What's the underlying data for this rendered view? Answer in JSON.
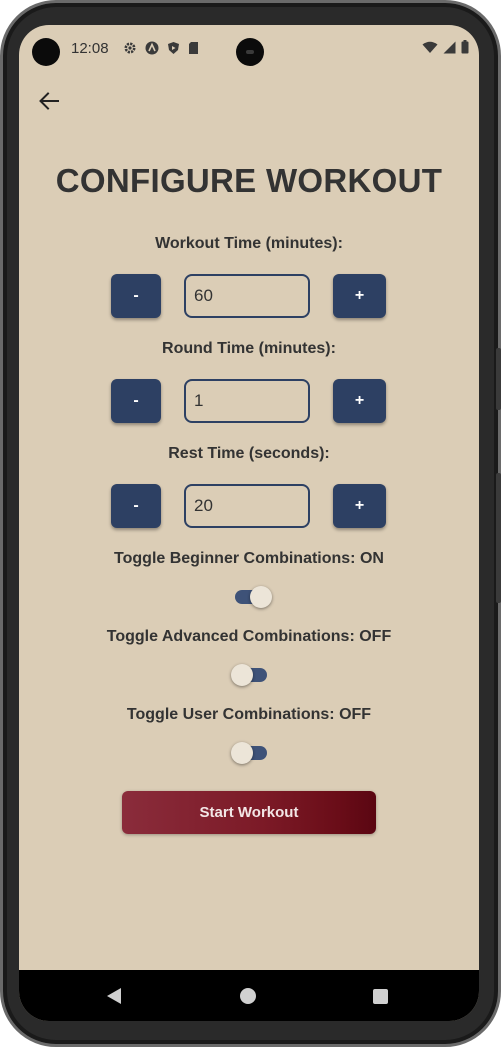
{
  "status_bar": {
    "time": "12:08",
    "left_icons": [
      "settings-icon",
      "app-icon",
      "shield-icon",
      "sd-card-icon"
    ],
    "right_icons": [
      "wifi-icon",
      "signal-icon",
      "battery-icon"
    ]
  },
  "header": {
    "back_icon": "arrow-left-icon",
    "title": "CONFIGURE WORKOUT"
  },
  "workout_time": {
    "label": "Workout Time (minutes):",
    "value": "60",
    "decrement_label": "-",
    "increment_label": "+"
  },
  "round_time": {
    "label": "Round Time (minutes):",
    "value": "1",
    "decrement_label": "-",
    "increment_label": "+"
  },
  "rest_time": {
    "label": "Rest Time (seconds):",
    "value": "20",
    "decrement_label": "-",
    "increment_label": "+"
  },
  "toggles": {
    "beginner": {
      "label": "Toggle Beginner Combinations: ON",
      "on": true
    },
    "advanced": {
      "label": "Toggle Advanced Combinations: OFF",
      "on": false
    },
    "user": {
      "label": "Toggle User Combinations: OFF",
      "on": false
    }
  },
  "start_button": {
    "label": "Start Workout"
  },
  "colors": {
    "background": "#dbcdb6",
    "primary": "#2d4063",
    "text": "#333333",
    "start_button": "#7c1a27"
  },
  "nav_bar": {
    "icons": [
      "back-triangle-icon",
      "home-circle-icon",
      "recents-square-icon"
    ]
  }
}
